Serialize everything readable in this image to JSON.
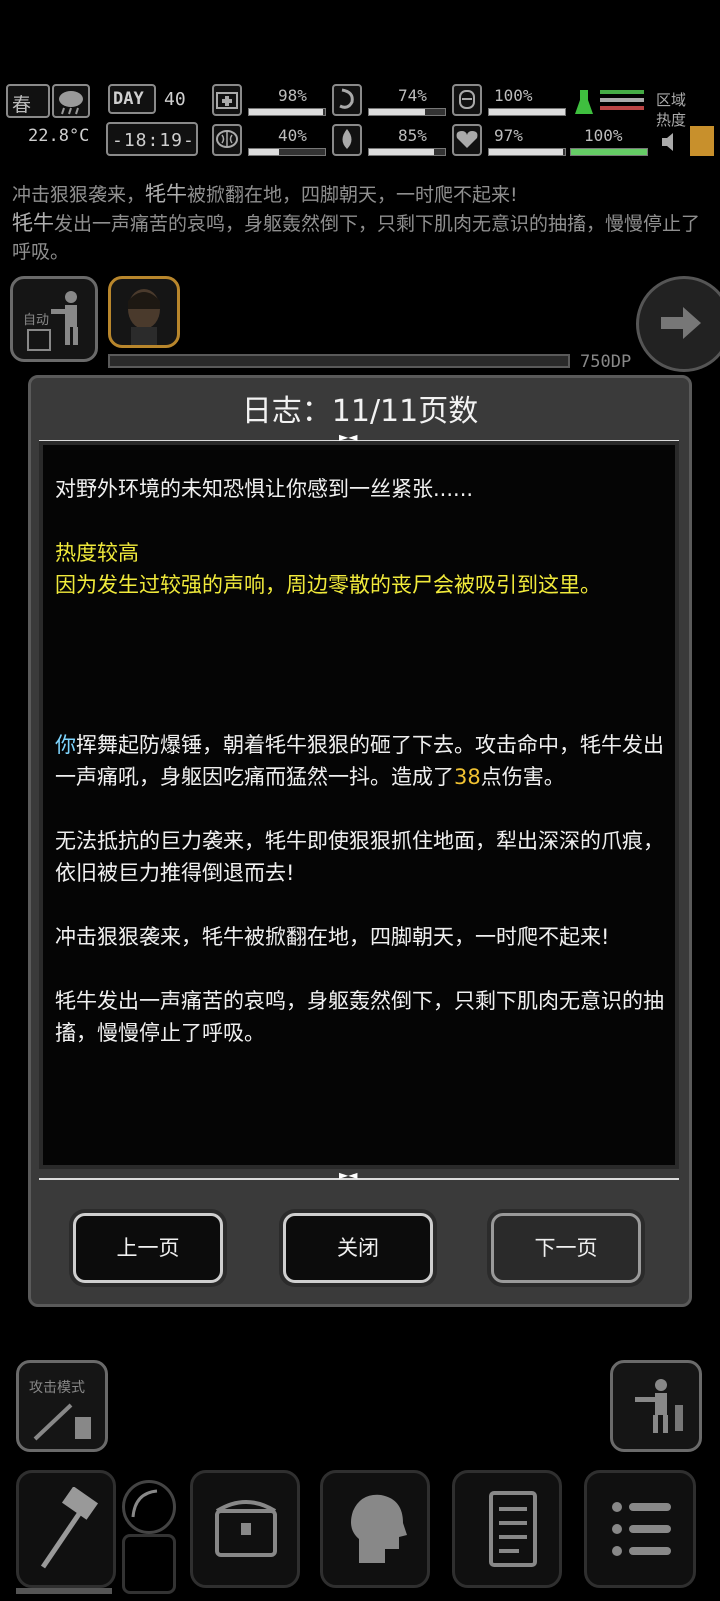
{
  "status": {
    "season": "春",
    "day_label": "DAY",
    "day": "40",
    "temperature": "22.8°C",
    "time": "-18:19-",
    "stats": [
      {
        "name": "health",
        "value": "98%"
      },
      {
        "name": "hunger",
        "value": "74%"
      },
      {
        "name": "stamina",
        "value": "100%"
      },
      {
        "name": "sanity",
        "value": "40%"
      },
      {
        "name": "thirst",
        "value": "85%"
      },
      {
        "name": "heart",
        "value": "97%"
      },
      {
        "name": "energy",
        "value": "100%"
      }
    ],
    "area_label": "区域热度"
  },
  "background_log": {
    "line1_pre": "冲击狠狠袭来，",
    "line1_name": "牦牛",
    "line1_post": "被掀翻在地，四脚朝天，一时爬不起来!",
    "line2_name": "牦牛",
    "line2_post": "发出一声痛苦的哀鸣，身躯轰然倒下，只剩下肌肉无意识的抽搐，慢慢停止了呼吸。"
  },
  "combat": {
    "auto_label": "自动",
    "points": "750DP"
  },
  "modal": {
    "title": "日志：11/11页数",
    "log": {
      "p1": "对野外环境的未知恐惧让你感到一丝紧张......",
      "heat_title": "热度较高",
      "heat_text": "因为发生过较强的声响，周边零散的丧尸会被吸引到这里。",
      "attack_you": "你",
      "attack_pre": "挥舞起防爆锤，朝着牦牛狠狠的砸了下去。攻击命中，牦牛发出一声痛吼，身躯因吃痛而猛然一抖。造成了",
      "attack_damage": "38",
      "attack_post": "点伤害。",
      "p4": "无法抵抗的巨力袭来，牦牛即使狠狠抓住地面，犁出深深的爪痕，依旧被巨力推得倒退而去!",
      "p5": "冲击狠狠袭来，牦牛被掀翻在地，四脚朝天，一时爬不起来!",
      "p6": "牦牛发出一声痛苦的哀鸣，身躯轰然倒下，只剩下肌肉无意识的抽搐，慢慢停止了呼吸。"
    },
    "buttons": {
      "prev": "上一页",
      "close": "关闭",
      "next": "下一页"
    }
  },
  "bottom": {
    "attack_mode_label": "攻击模式"
  }
}
